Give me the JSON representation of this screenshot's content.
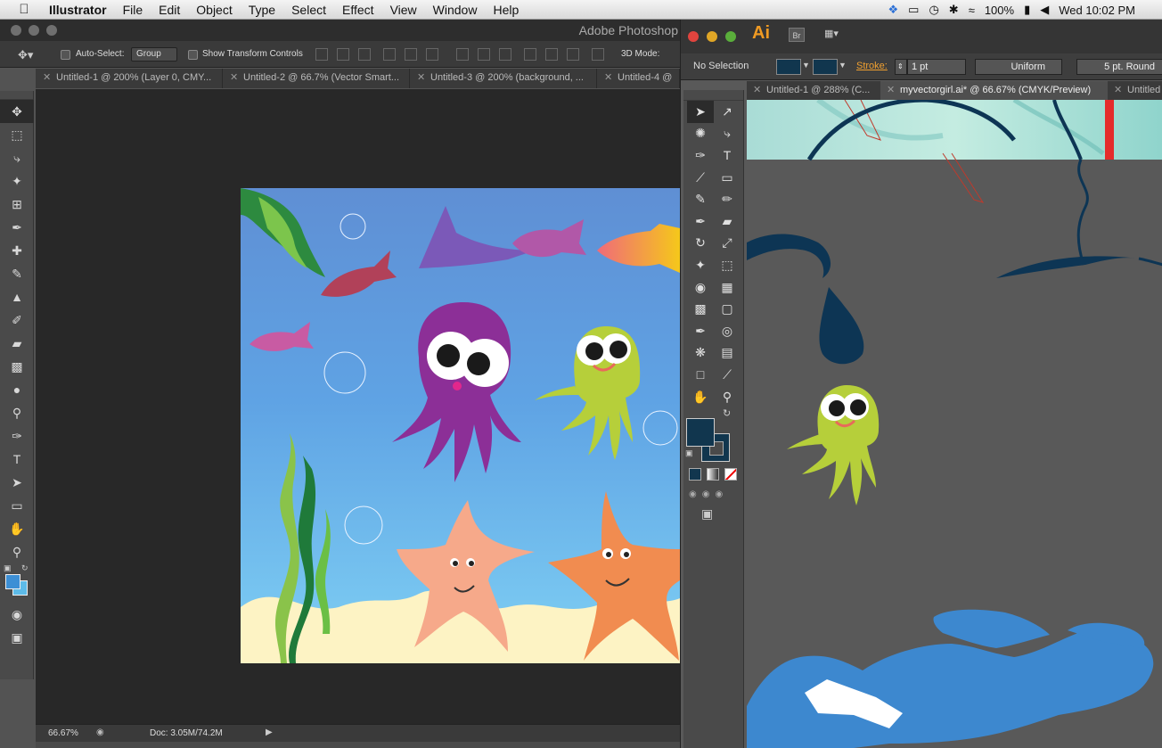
{
  "menubar": {
    "app_name": "Illustrator",
    "items": [
      "File",
      "Edit",
      "Object",
      "Type",
      "Select",
      "Effect",
      "View",
      "Window",
      "Help"
    ],
    "battery": "100%",
    "clock": "Wed 10:02 PM"
  },
  "photoshop": {
    "window_title": "Adobe Photoshop",
    "options": {
      "auto_select_label": "Auto-Select:",
      "auto_select_value": "Group",
      "transform_label": "Show Transform Controls",
      "mode_label": "3D Mode:"
    },
    "tabs": [
      "Untitled-1 @ 200% (Layer 0, CMY...",
      "Untitled-2 @ 66.7% (Vector Smart...",
      "Untitled-3 @ 200% (background, ...",
      "Untitled-4 @"
    ],
    "status": {
      "zoom": "66.67%",
      "doc": "Doc: 3.05M/74.2M"
    },
    "colors": {
      "foreground": "#3d8fd5",
      "background": "#5dbbe8"
    }
  },
  "illustrator": {
    "logo": "Ai",
    "bridge": "Br",
    "control": {
      "selection": "No Selection",
      "stroke_label": "Stroke:",
      "stroke_weight": "1 pt",
      "profile": "Uniform",
      "brush": "5 pt. Round"
    },
    "tabs": [
      "Untitled-1 @ 288% (C...",
      "myvectorgirl.ai* @ 66.67% (CMYK/Preview)",
      "Untitled"
    ],
    "colors": {
      "fill": "#11364e",
      "stroke": "#11364e"
    }
  }
}
